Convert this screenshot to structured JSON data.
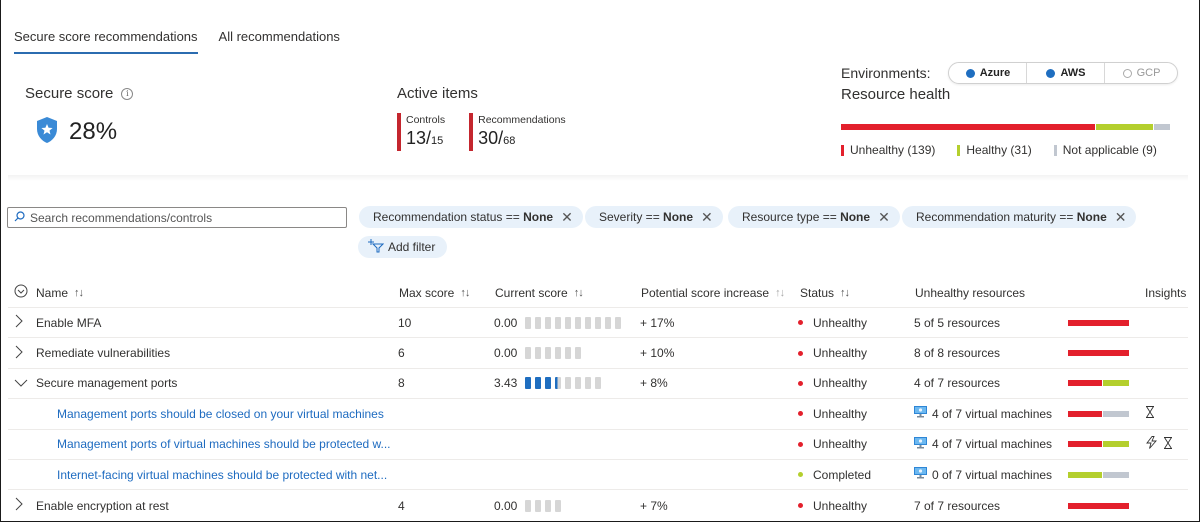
{
  "tabs": [
    {
      "label": "Secure score recommendations",
      "active": true
    },
    {
      "label": "All recommendations",
      "active": false
    }
  ],
  "secure_score": {
    "title": "Secure score",
    "info_icon": "info-icon",
    "icon": "shield-star-icon",
    "value": "28%"
  },
  "active_items": {
    "title": "Active items",
    "controls": {
      "label": "Controls",
      "value": "13/",
      "total": "15"
    },
    "recommendations": {
      "label": "Recommendations",
      "value": "30/",
      "total": "68"
    }
  },
  "environments": {
    "label": "Environments:",
    "options": [
      {
        "label": "Azure",
        "selected": true
      },
      {
        "label": "AWS",
        "selected": true
      },
      {
        "label": "GCP",
        "selected": false
      }
    ]
  },
  "resource_health": {
    "title": "Resource health",
    "segments": [
      {
        "label": "Unhealthy",
        "count": 139,
        "legend": "Unhealthy (139)",
        "color": "#e3202c"
      },
      {
        "label": "Healthy",
        "count": 31,
        "legend": "Healthy (31)",
        "color": "#b4cf2d"
      },
      {
        "label": "Not applicable",
        "count": 9,
        "legend": "Not applicable (9)",
        "color": "#c1c7d0"
      }
    ]
  },
  "search": {
    "placeholder": "Search recommendations/controls",
    "value": ""
  },
  "filters": [
    {
      "key": "Recommendation status == ",
      "value": "None"
    },
    {
      "key": "Severity == ",
      "value": "None"
    },
    {
      "key": "Resource type == ",
      "value": "None"
    },
    {
      "key": "Recommendation maturity == ",
      "value": "None"
    }
  ],
  "add_filter_label": "Add filter",
  "table": {
    "columns": {
      "name": "Name",
      "max_score": "Max score",
      "current_score": "Current score",
      "potential": "Potential score increase",
      "status": "Status",
      "unhealthy": "Unhealthy resources",
      "insights": "Insights"
    },
    "rows": [
      {
        "type": "control",
        "expanded": false,
        "name": "Enable MFA",
        "max_score": "10",
        "current_score": "0.00",
        "score_filled": 0,
        "potential": "+ 17%",
        "status": "Unhealthy",
        "status_color": "#e3202c",
        "unhealthy": "5 of 5 resources",
        "health": {
          "unhealthy": 5,
          "healthy": 0,
          "na": 0
        },
        "insights": []
      },
      {
        "type": "control",
        "expanded": false,
        "name": "Remediate vulnerabilities",
        "max_score": "6",
        "current_score": "0.00",
        "score_filled": 0,
        "potential": "+ 10%",
        "status": "Unhealthy",
        "status_color": "#e3202c",
        "unhealthy": "8 of 8 resources",
        "health": {
          "unhealthy": 8,
          "healthy": 0,
          "na": 0
        },
        "insights": []
      },
      {
        "type": "control",
        "expanded": true,
        "name": "Secure management ports",
        "max_score": "8",
        "current_score": "3.43",
        "score_filled": 3.43,
        "potential": "+ 8%",
        "status": "Unhealthy",
        "status_color": "#e3202c",
        "unhealthy": "4 of 7 resources",
        "health": {
          "unhealthy": 4,
          "healthy": 3,
          "na": 0
        },
        "insights": []
      },
      {
        "type": "recommendation",
        "name": "Management ports should be closed on your virtual machines",
        "status": "Unhealthy",
        "status_color": "#e3202c",
        "unhealthy": "4 of 7 virtual machines",
        "health": {
          "unhealthy": 4,
          "healthy": 0,
          "na": 3
        },
        "insights": [
          "hourglass-icon"
        ]
      },
      {
        "type": "recommendation",
        "name": "Management ports of virtual machines should be protected w...",
        "status": "Unhealthy",
        "status_color": "#e3202c",
        "unhealthy": "4 of 7 virtual machines",
        "health": {
          "unhealthy": 4,
          "healthy": 3,
          "na": 0
        },
        "insights": [
          "quick-fix-icon",
          "hourglass-icon"
        ]
      },
      {
        "type": "recommendation",
        "name": "Internet-facing virtual machines should be protected with net...",
        "status": "Completed",
        "status_color": "#b4cf2d",
        "unhealthy": "0 of 7 virtual machines",
        "health": {
          "unhealthy": 0,
          "healthy": 4,
          "na": 3
        },
        "insights": []
      },
      {
        "type": "control",
        "expanded": false,
        "name": "Enable encryption at rest",
        "max_score": "4",
        "current_score": "0.00",
        "score_filled": 0,
        "potential": "+ 7%",
        "status": "Unhealthy",
        "status_color": "#e3202c",
        "unhealthy": "7 of 7 resources",
        "health": {
          "unhealthy": 7,
          "healthy": 0,
          "na": 0
        },
        "insights": []
      }
    ]
  }
}
